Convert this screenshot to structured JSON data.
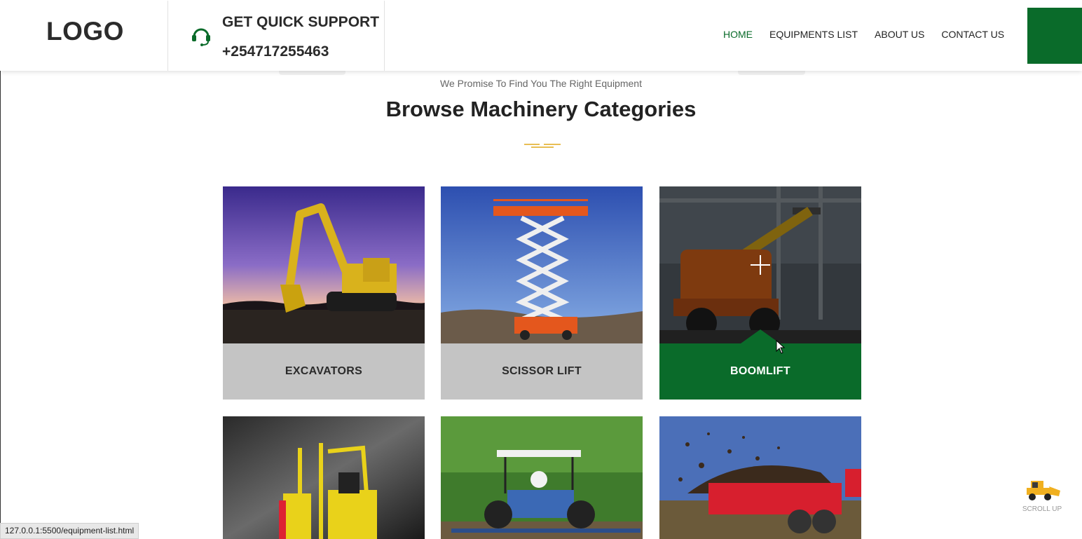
{
  "header": {
    "logo": "LOGO",
    "support_title": "GET QUICK SUPPORT",
    "support_phone": "+254717255463",
    "nav": [
      {
        "label": "HOME",
        "active": true
      },
      {
        "label": "EQUIPMENTS LIST",
        "active": false
      },
      {
        "label": "ABOUT US",
        "active": false
      },
      {
        "label": "CONTACT US",
        "active": false
      }
    ]
  },
  "section": {
    "subtitle": "We Promise To Find You The Right Equipment",
    "title": "Browse Machinery Categories"
  },
  "categories": [
    {
      "label": "EXCAVATORS",
      "icon": "excavator-image"
    },
    {
      "label": "SCISSOR LIFT",
      "icon": "scissor-lift-image"
    },
    {
      "label": "BOOMLIFT",
      "icon": "boom-lift-image",
      "active": true
    },
    {
      "label": "",
      "icon": "forklift-image"
    },
    {
      "label": "",
      "icon": "tractor-image"
    },
    {
      "label": "",
      "icon": "spreader-image"
    }
  ],
  "scroll_up": {
    "label": "SCROLL UP",
    "icon": "loader-icon"
  },
  "status_bar": {
    "url": "127.0.0.1:5500/equipment-list.html"
  },
  "colors": {
    "brand": "#0a6b2a",
    "accent": "#e0a81c",
    "caption_bg": "#c4c4c4"
  }
}
